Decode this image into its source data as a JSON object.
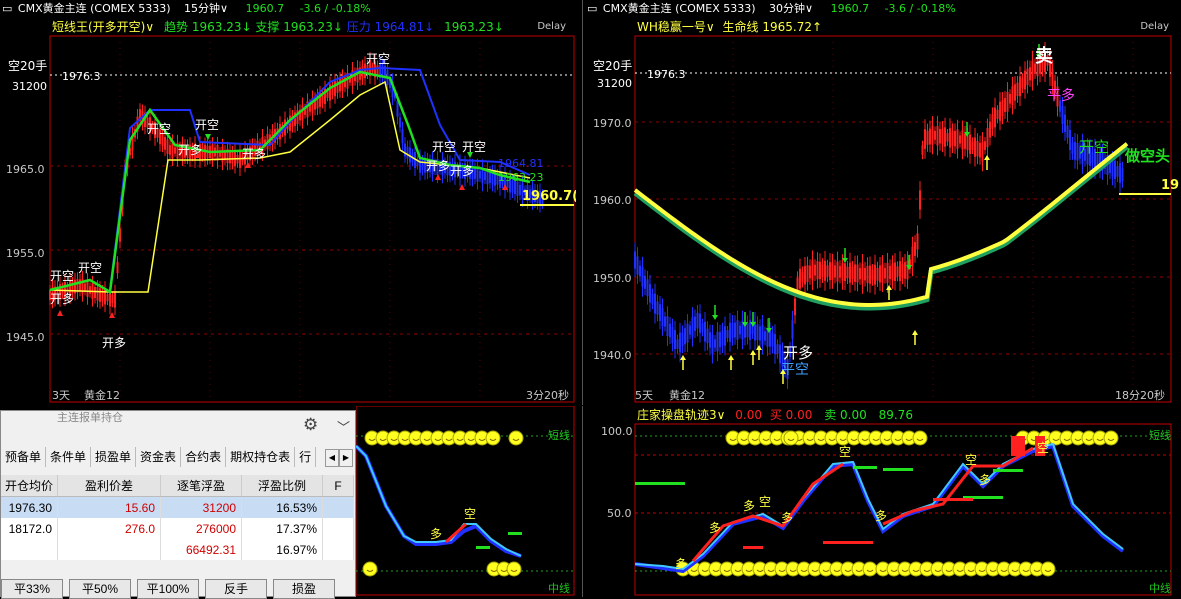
{
  "left": {
    "header": {
      "menu_glyph": "▭",
      "symbol": "CMX黄金主连",
      "exchange": "(COMEX 5333)",
      "period": "15分钟",
      "price": "1960.7",
      "change": "-3.6 / -0.18%"
    },
    "indicator": {
      "name": "短线王(开多开空)",
      "trend_label": "趋势",
      "trend_value": "1963.23↓",
      "support_label": "支撑",
      "support_value": "1963.23↓",
      "pressure_label": "压力",
      "pressure_value": "1964.81↓",
      "extra_value": "1963.23↓",
      "delay": "Delay"
    },
    "position_label": "空20手",
    "position_price": "31200",
    "hline_value": "1976.3",
    "y_ticks": [
      "1965.0",
      "1955.0",
      "1945.0"
    ],
    "line_labels": {
      "pressure": "1964.81",
      "support": "1963.23"
    },
    "last_price": "1960.7(",
    "signals": {
      "open_short": "开空",
      "open_long": "开多",
      "open_long_2": "开多"
    },
    "footer_left": "3天",
    "footer_sub": "黄金12",
    "footer_right": "3分20秒",
    "sub_label_right": "短线",
    "sub_label_mid": "中线",
    "sub_text_duo": "多",
    "sub_text_kong": "空"
  },
  "right": {
    "header": {
      "menu_glyph": "▭",
      "symbol": "CMX黄金主连",
      "exchange": "(COMEX 5333)",
      "period": "30分钟",
      "price": "1960.7",
      "change": "-3.6 / -0.18%"
    },
    "indicator": {
      "name": "WH稳赢一号",
      "life_label": "生命线",
      "life_value": "1965.72↑",
      "delay": "Delay"
    },
    "position_label": "空20手",
    "position_price": "31200",
    "hline_value": "1976.3",
    "y_ticks": [
      "1970.0",
      "1960.0",
      "1950.0",
      "1940.0"
    ],
    "signals": {
      "sell": "卖",
      "close_long": "平多",
      "open_short": "开空",
      "do_short": "做空头",
      "open_long": "开多",
      "close_short": "平空"
    },
    "last_price": "19",
    "footer_left": "5天",
    "footer_sub": "黄金12",
    "footer_right": "18分20秒",
    "sub": {
      "name": "庄家操盘轨迹3",
      "v1": "0.00",
      "buy_label": "买",
      "buy": "0.00",
      "sell_label": "卖",
      "sell": "0.00",
      "v4": "89.76",
      "y_ticks": [
        "100.0",
        "50.0"
      ],
      "label_right": "短线",
      "label_mid": "中线",
      "duo": "多",
      "kong": "空"
    }
  },
  "trade_panel": {
    "title": "主连报单持仓",
    "gear": "⚙",
    "collapse": "﹀",
    "tabs": [
      "预备单",
      "条件单",
      "损盈单",
      "资金表",
      "合约表",
      "期权持仓表",
      "行"
    ],
    "columns": [
      "开仓均价",
      "盈利价差",
      "逐笔浮盈",
      "浮盈比例",
      "F"
    ],
    "rows": [
      [
        "1976.30",
        "15.60",
        "31200",
        "16.53%"
      ],
      [
        "18172.0",
        "276.0",
        "276000",
        "17.37%"
      ],
      [
        "",
        "",
        "66492.31",
        "16.97%"
      ]
    ],
    "buttons": [
      "平33%",
      "平50%",
      "平100%",
      "反手",
      "损盈"
    ]
  },
  "colors": {
    "up": "#ff2020",
    "down": "#2030ff",
    "trend": "#ffff40",
    "support": "#20e020",
    "cyan": "#40c8ff"
  }
}
